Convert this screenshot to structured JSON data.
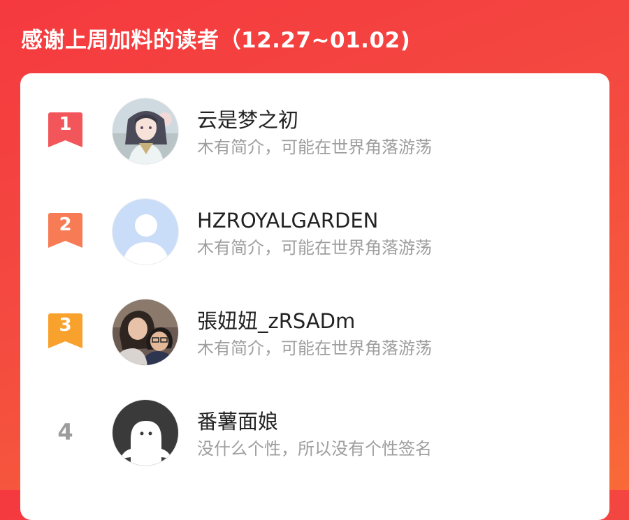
{
  "header": {
    "title": "感谢上周加料的读者（12.27~01.02)"
  },
  "readers": [
    {
      "rank": "1",
      "name": "云是梦之初",
      "bio": "木有简介，可能在世界角落游荡",
      "badge_color": "#f2565a",
      "avatar": "anime-portrait-avatar"
    },
    {
      "rank": "2",
      "name": "HZROYALGARDEN",
      "bio": "木有简介，可能在世界角落游荡",
      "badge_color": "#f77c55",
      "avatar": "default-user-avatar"
    },
    {
      "rank": "3",
      "name": "張妞妞_zRSADm",
      "bio": "木有简介，可能在世界角落游荡",
      "badge_color": "#f9a12d",
      "avatar": "photo-couple-avatar"
    },
    {
      "rank": "4",
      "name": "番薯面娘",
      "bio": "没什么个性，所以没有个性签名",
      "badge_color": "#9c9c9c",
      "avatar": "ghost-figure-avatar"
    }
  ],
  "colors": {
    "background_start": "#f5393f",
    "background_end": "#f96a38",
    "card": "#ffffff",
    "name_text": "#222222",
    "bio_text": "#9e9e9e"
  }
}
